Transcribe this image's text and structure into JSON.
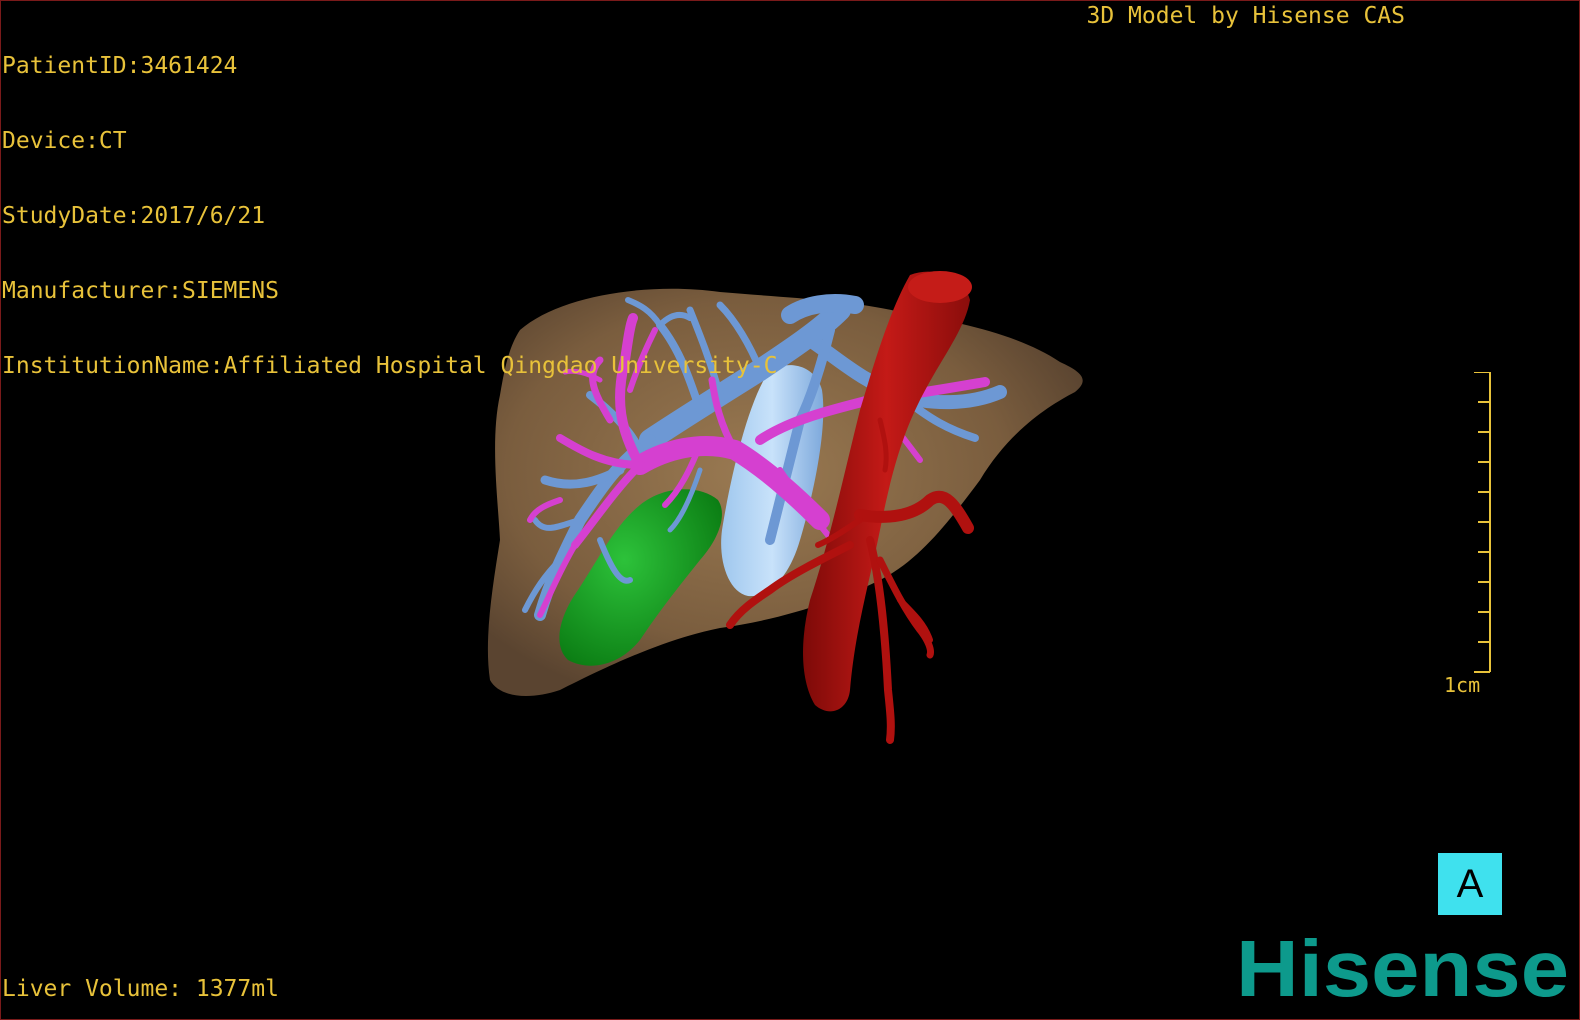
{
  "header": {
    "patient_id": "PatientID:3461424",
    "device": "Device:CT",
    "study_date": "StudyDate:2017/6/21",
    "manufacturer": "Manufacturer:SIEMENS",
    "institution": "InstitutionName:Affiliated Hospital Qingdao University-C",
    "credit": "3D Model by Hisense CAS"
  },
  "footer": {
    "liver_volume": "Liver Volume: 1377ml"
  },
  "scale_bar": {
    "label": "1cm",
    "tick_count": 11
  },
  "view_badge": {
    "label": "A"
  },
  "brand": {
    "logo_text": "Hisense"
  },
  "colors": {
    "hud_text": "#e8c23a",
    "liver": "#8a6b47",
    "portal_vein": "#6d98d4",
    "hepatic_vein": "#d540d0",
    "artery": "#b0110f",
    "gallbladder": "#0f9a1a",
    "badge_bg": "#3fe1ee",
    "brand": "#0d9a8c"
  }
}
